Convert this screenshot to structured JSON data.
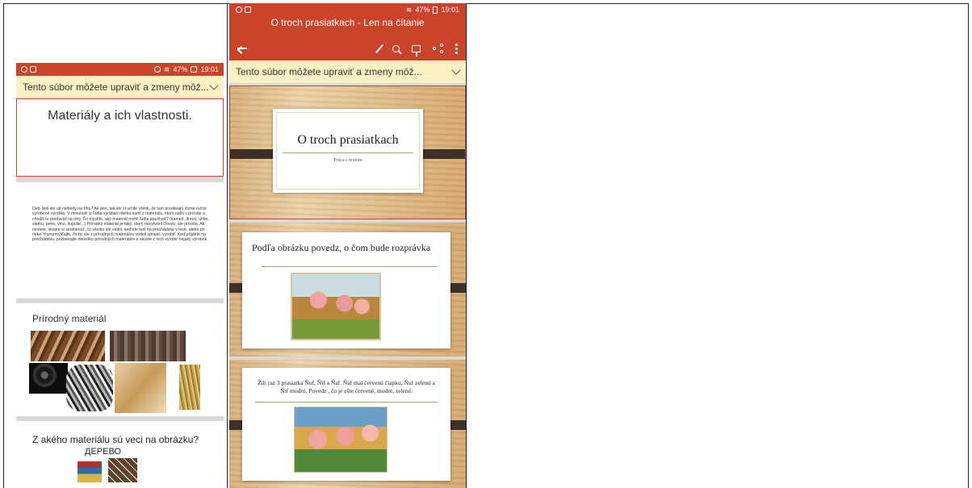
{
  "colors": {
    "accent": "#c9442a",
    "banner": "#fcefc4",
    "background": "#d9d9d9"
  },
  "left_phone": {
    "status": {
      "time": "19:01",
      "battery": "47%",
      "icons": [
        "wifi-icon",
        "signal-icon",
        "battery-icon"
      ]
    },
    "banner": {
      "text": "Tento súbor môžete upraviť a zmeny môž..."
    },
    "slides": [
      {
        "title": "Materiály a ich vlastnosti."
      },
      {
        "body": "Deti, boli ste už niekedy na trhu? Ak áno, tak ste si určite všimli, že tam predávajú rôzne ručne vyrobené výrobky. V minulosti si ľudia vyrábali všetko sami z materiálu, ktorý našli v prírode a chodili to predávať na trhy. Čo myslíte, aký materiál mohli ľudia používať? (kameň, drevo, uhlie, slamu, perie, vlnu, šupolie...) Prírodný materiál je taký, ktorý nevytvoril človek, ale príroda. Ak neviete, skúste si spomenúť, čo všetko ste videli, keď ste boli na prechádzke v lese, alebo pri rieke. Porozmýšľajte, čo by ste z prírodných materiálov vedeli spraviť, vyrobiť. Keď pôjdete na prechádzku, pozbierajte niekoľko prírodných materiálov a skúste z nich vyrobiť nejaký výrobok."
      },
      {
        "title": "Prírodný materiál"
      },
      {
        "title": "Z akého materiálu sú veci na obrázku?",
        "subtitle": "ДЕРЕВО"
      }
    ]
  },
  "right_phone": {
    "status": {
      "time": "19:01",
      "battery": "47%"
    },
    "title": "O troch prasiatkach - Len na čítanie",
    "banner": {
      "text": "Tento súbor môžete upraviť a zmeny môž..."
    },
    "slides": [
      {
        "title": "O troch prasiatkach",
        "subtitle": "Práca s textom"
      },
      {
        "title": "Podľa obrázku povedz, o čom bude rozprávka"
      },
      {
        "body": "Žili raz 3 prasiatka Ňuf, Ňif a Ňaf. Ňaf mal červenú čiapku, Ňuf zelenú a Ňif modrú. Povedz , čo je ešte červené, modré, zelené."
      }
    ]
  }
}
